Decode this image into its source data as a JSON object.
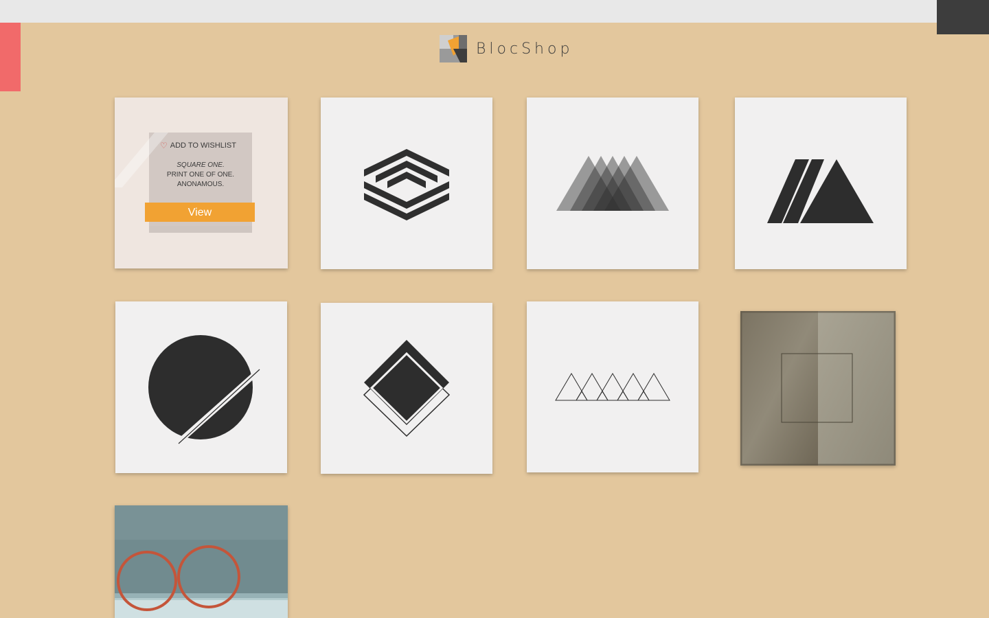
{
  "brand": {
    "name": "BlocShop",
    "colors": {
      "background": "#e3c79d",
      "accent": "#f1a233",
      "side_tab": "#f16a6a"
    }
  },
  "featured_item": {
    "wishlist_label": "ADD TO WISHLIST",
    "title": "SQUARE ONE.",
    "edition": "PRINT ONE OF ONE.",
    "artist": "ANONAMOUS.",
    "view_label": "View"
  },
  "products": [
    {
      "icon": "stacked-square-lines-icon"
    },
    {
      "icon": "overlapping-triangles-icon"
    },
    {
      "icon": "three-mountains-icon"
    },
    {
      "icon": "sliced-circle-icon"
    },
    {
      "icon": "layered-diamond-icon"
    },
    {
      "icon": "outline-triangles-icon"
    },
    {
      "icon": "textured-paper-square-icon"
    },
    {
      "icon": "orange-rings-painting-icon"
    }
  ]
}
